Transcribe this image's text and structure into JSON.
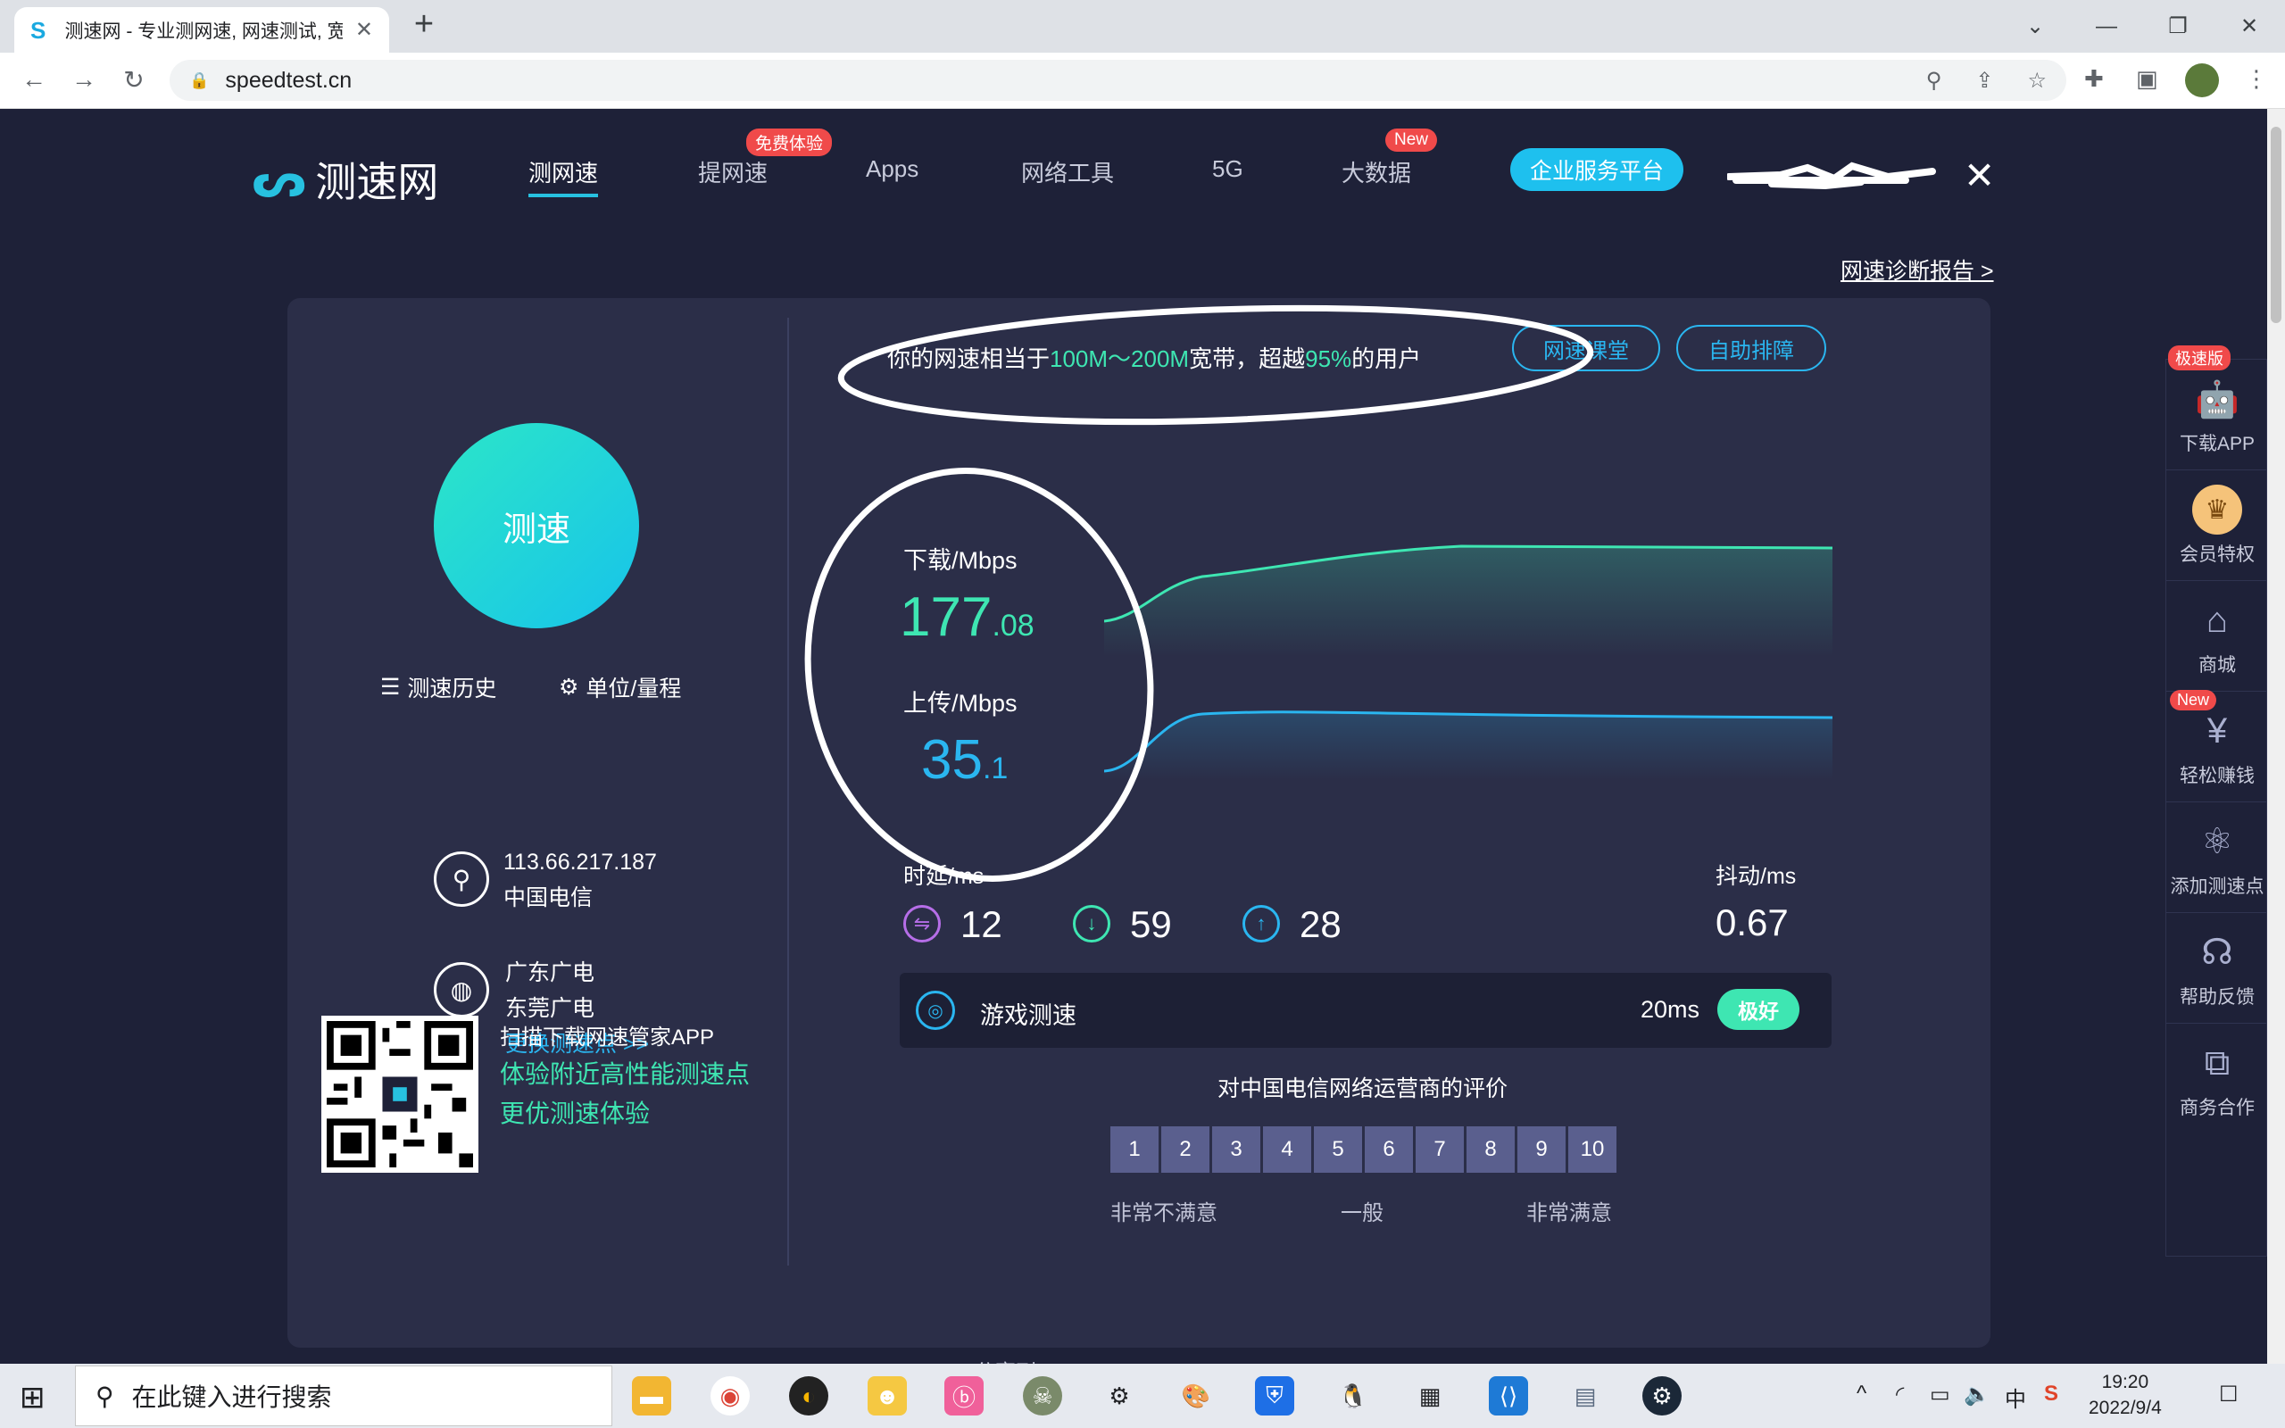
{
  "browser": {
    "tab_title": "测速网 - 专业测网速, 网速测试, 宽",
    "url": "speedtest.cn"
  },
  "site": {
    "logo_text": "测速网",
    "nav": [
      "测网速",
      "提网速",
      "Apps",
      "网络工具",
      "5G",
      "大数据"
    ],
    "nav_badge_free": "免费体验",
    "nav_badge_new": "New",
    "enterprise_button": "企业服务平台",
    "report_link": "网速诊断报告 >"
  },
  "left": {
    "go_button": "测速",
    "history": "测速历史",
    "units": "单位/量程",
    "ip": "113.66.217.187",
    "isp": "中国电信",
    "server_name": "广东广电",
    "server_city": "东莞广电",
    "change_server": "更换测速点 >>",
    "qr_title": "扫描下载网速管家APP",
    "qr_line1": "体验附近高性能测速点",
    "qr_line2": "更优测速体验"
  },
  "result": {
    "summary_prefix": "你的网速相当于",
    "summary_band": "100M～200M",
    "summary_mid": "宽带，超越",
    "summary_pct": "95%",
    "summary_suffix": "的用户",
    "btn_course": "网速课堂",
    "btn_fix": "自助排障",
    "download_label": "下载/Mbps",
    "download_int": "177",
    "download_dec": ".08",
    "upload_label": "上传/Mbps",
    "upload_int": "35",
    "upload_dec": ".1",
    "latency_label": "时延/ms",
    "latency_idle": "12",
    "latency_down": "59",
    "latency_up": "28",
    "jitter_label": "抖动/ms",
    "jitter": "0.67",
    "game_label": "游戏测速",
    "game_value": "20ms",
    "game_badge": "极好",
    "eval_title": "对中国电信网络运营商的评价",
    "rating": [
      "1",
      "2",
      "3",
      "4",
      "5",
      "6",
      "7",
      "8",
      "9",
      "10"
    ],
    "rating_low": "非常不满意",
    "rating_mid": "一般",
    "rating_high": "非常满意"
  },
  "sidebar": {
    "badge_fast": "极速版",
    "badge_new": "New",
    "items": [
      "下载APP",
      "会员特权",
      "商城",
      "轻松赚钱",
      "添加测速点",
      "帮助反馈",
      "商务合作"
    ]
  },
  "footer_partial": "分享到",
  "taskbar": {
    "search_placeholder": "在此键入进行搜索",
    "ime": "中",
    "time": "19:20",
    "date": "2022/9/4"
  },
  "colors": {
    "page_bg": "#1e2138",
    "card_bg": "#2b2e48",
    "accent_green": "#3ee6b2",
    "accent_blue": "#2ab6f0",
    "enterprise_btn": "#1ec0ee"
  }
}
